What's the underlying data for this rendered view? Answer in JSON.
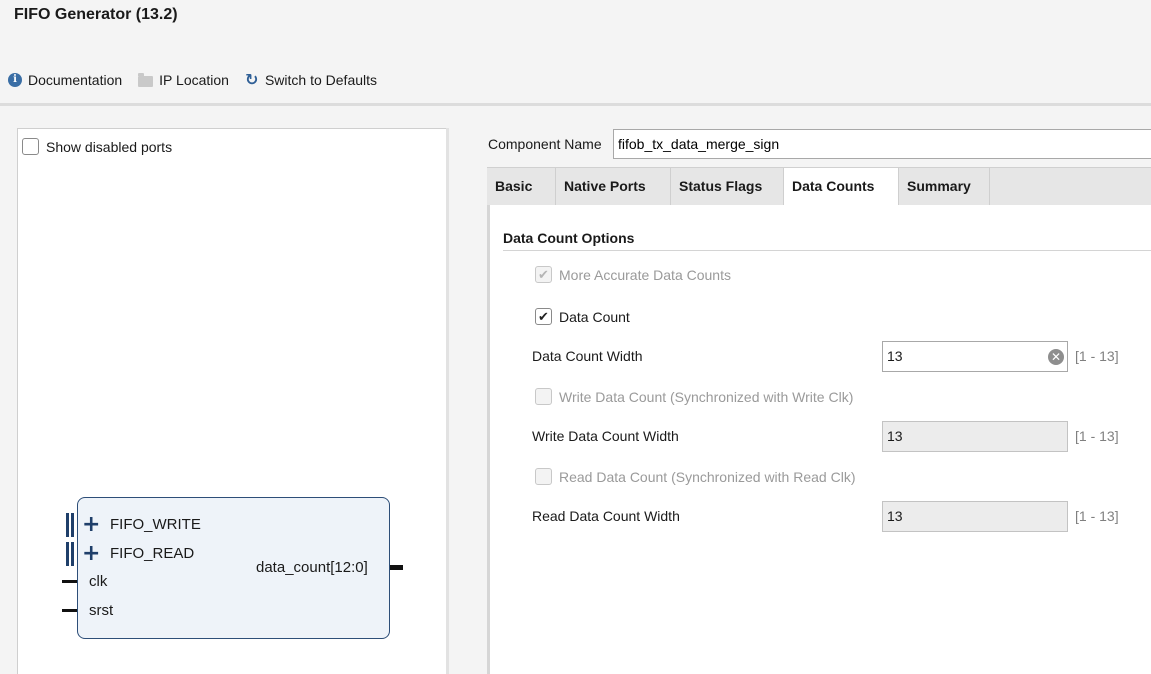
{
  "window": {
    "title": "FIFO Generator (13.2)"
  },
  "toolbar": {
    "documentation": "Documentation",
    "ip_location": "IP Location",
    "switch_defaults": "Switch to Defaults"
  },
  "left_panel": {
    "show_disabled_ports": "Show disabled ports",
    "show_disabled_checked": false,
    "symbol": {
      "ports_left": [
        "FIFO_WRITE",
        "FIFO_READ",
        "clk",
        "srst"
      ],
      "ports_right": [
        "data_count[12:0]"
      ]
    }
  },
  "component": {
    "label": "Component Name",
    "value": "fifob_tx_data_merge_sign"
  },
  "tabs": [
    {
      "label": "Basic",
      "active": false
    },
    {
      "label": "Native Ports",
      "active": false
    },
    {
      "label": "Status Flags",
      "active": false
    },
    {
      "label": "Data Counts",
      "active": true
    },
    {
      "label": "Summary",
      "active": false
    }
  ],
  "data_count_options": {
    "title": "Data Count Options",
    "more_accurate": {
      "label": "More Accurate Data Counts",
      "checked": true,
      "enabled": false
    },
    "data_count": {
      "label": "Data Count",
      "checked": true,
      "enabled": true
    },
    "data_count_width": {
      "label": "Data Count Width",
      "value": "13",
      "range": "[1 - 13]",
      "enabled": true
    },
    "write_data_count": {
      "label": "Write Data Count (Synchronized with Write Clk)",
      "checked": false,
      "enabled": false
    },
    "write_data_count_width": {
      "label": "Write Data Count Width",
      "value": "13",
      "range": "[1 - 13]",
      "enabled": false
    },
    "read_data_count": {
      "label": "Read Data Count (Synchronized with Read Clk)",
      "checked": false,
      "enabled": false
    },
    "read_data_count_width": {
      "label": "Read Data Count Width",
      "value": "13",
      "range": "[1 - 13]",
      "enabled": false
    }
  }
}
